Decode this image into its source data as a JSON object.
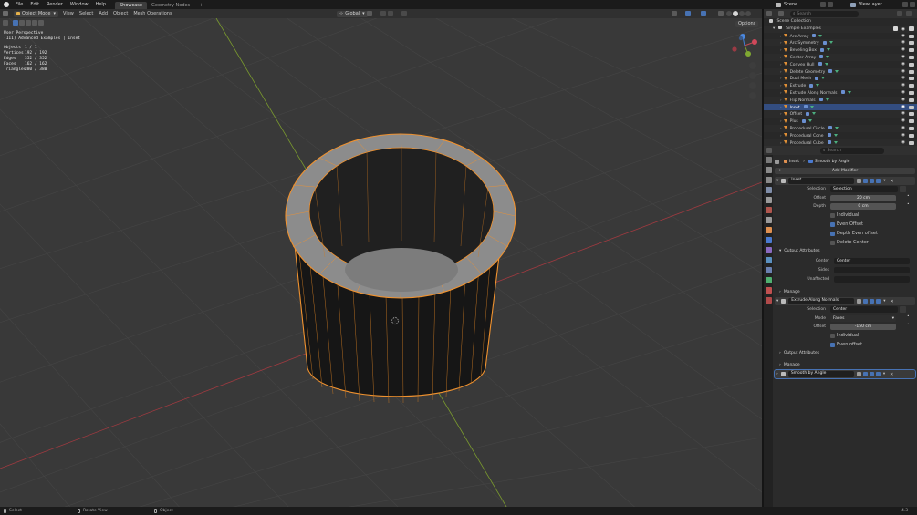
{
  "menu": {
    "items": [
      "File",
      "Edit",
      "Render",
      "Window",
      "Help"
    ],
    "tabs": [
      "Showcase",
      "Geometry Nodes"
    ],
    "active_tab": "Showcase",
    "add_tab": "+",
    "scene": "Scene",
    "view_layer": "ViewLayer"
  },
  "viewport_header": {
    "mode": "Object Mode",
    "menus": [
      "View",
      "Select",
      "Add",
      "Object",
      "Mesh Operations"
    ],
    "transform": "Global",
    "options": "Options"
  },
  "overlay": {
    "view_name": "User Perspective",
    "object_line": "(111) Advanced Examples | Inset",
    "stats": [
      {
        "label": "Objects",
        "value": "1 / 1"
      },
      {
        "label": "Vertices",
        "value": "192 / 192"
      },
      {
        "label": "Edges",
        "value": "352 / 352"
      },
      {
        "label": "Faces",
        "value": "162 / 162"
      },
      {
        "label": "Triangles",
        "value": "380 / 380"
      }
    ]
  },
  "outliner": {
    "search_placeholder": "Search",
    "collection": "Scene Collection",
    "group": "Simple Examples",
    "items": [
      "Arc Array",
      "Arc Symmetry",
      "Beveling Box",
      "Center Array",
      "Convex Hull",
      "Delete Geometry",
      "Dual Mesh",
      "Extrude",
      "Extrude Along Normals",
      "Flip Normals",
      "Inset",
      "Offset",
      "Plus",
      "Procedural Circle",
      "Procedural Cone",
      "Procedural Cube"
    ],
    "selected": "Inset"
  },
  "properties": {
    "search_placeholder": "Search",
    "breadcrumb": [
      "Inset",
      "Smooth by Angle"
    ],
    "add_modifier": "Add Modifier",
    "mod1": {
      "name": "Inset",
      "selection_label": "Selection",
      "selection_value": "Selection",
      "offset_label": "Offset",
      "offset_value": "20 cm",
      "depth_label": "Depth",
      "depth_value": "0 cm",
      "individual": "Individual",
      "even_offset": "Even Offset",
      "depth_even_offset": "Depth Even offset",
      "delete_center": "Delete Center",
      "output_attributes": "Output Attributes",
      "center_label": "Center",
      "center_value": "Center",
      "sides_label": "Sides",
      "unaffected_label": "Unaffected",
      "manage": "Manage"
    },
    "mod2": {
      "name": "Extrude Along Normals",
      "selection_label": "Selection",
      "selection_value": "Center",
      "mode_label": "Mode",
      "mode_value": "Faces",
      "offset_label": "Offset",
      "offset_value": "-150 cm",
      "individual": "Individual",
      "even_offset": "Even offset",
      "output_attributes": "Output Attributes",
      "manage": "Manage"
    },
    "mod3": {
      "name": "Smooth by Angle"
    }
  },
  "statusbar": {
    "left": "Select",
    "middle": "Rotate View",
    "right": "Object",
    "version": "4.3"
  },
  "colors": {
    "selection_orange": "#f0922f",
    "accent_blue": "#4772b3",
    "x_axis": "#a03a40",
    "y_axis": "#7a9a2e"
  }
}
